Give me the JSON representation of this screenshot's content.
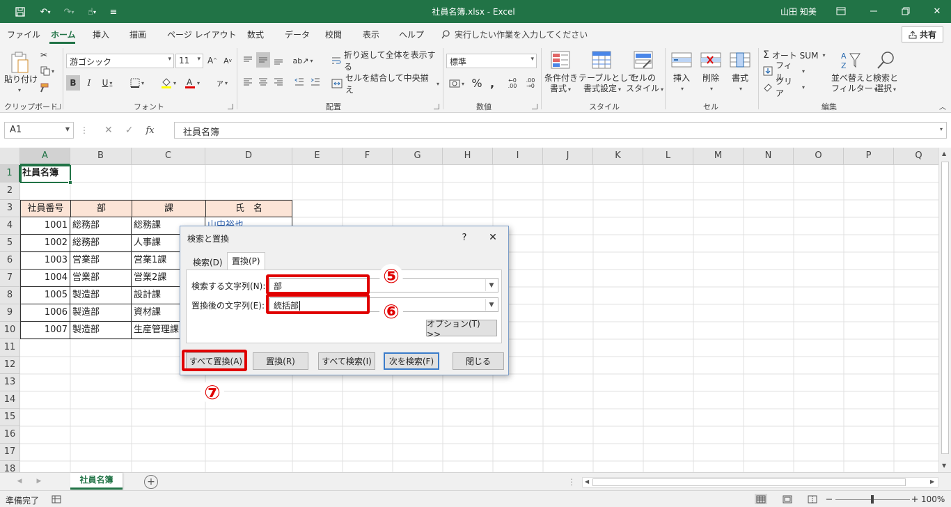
{
  "app": {
    "title": "社員名簿.xlsx  -  Excel",
    "user": "山田 知美"
  },
  "menu": {
    "tabs": [
      "ファイル",
      "ホーム",
      "挿入",
      "描画",
      "ページ レイアウト",
      "数式",
      "データ",
      "校閲",
      "表示",
      "ヘルプ"
    ],
    "tell_me": "実行したい作業を入力してください",
    "share": "共有"
  },
  "ribbon": {
    "clipboard": {
      "paste": "貼り付け",
      "label": "クリップボード"
    },
    "font": {
      "name": "游ゴシック",
      "size": "11",
      "label": "フォント"
    },
    "alignment": {
      "wrap": "折り返して全体を表示する",
      "merge": "セルを結合して中央揃え",
      "label": "配置"
    },
    "number": {
      "format": "標準",
      "label": "数値"
    },
    "styles": {
      "conditional": [
        "条件付き",
        "書式"
      ],
      "table": [
        "テーブルとして",
        "書式設定"
      ],
      "cellstyle": [
        "セルの",
        "スタイル"
      ],
      "label": "スタイル"
    },
    "cells": {
      "insert": "挿入",
      "delete": "削除",
      "format": "書式",
      "label": "セル"
    },
    "editing": {
      "autosum": "オート SUM",
      "fill": "フィル",
      "clear": "クリア",
      "sort": [
        "並べ替えと",
        "フィルター"
      ],
      "find": [
        "検索と",
        "選択"
      ],
      "label": "編集"
    }
  },
  "formula": {
    "namebox": "A1",
    "content": "社員名簿"
  },
  "grid": {
    "columns": [
      "A",
      "B",
      "C",
      "D",
      "E",
      "F",
      "G",
      "H",
      "I",
      "J",
      "K",
      "L",
      "M",
      "N",
      "O",
      "P",
      "Q"
    ],
    "rows": [
      "1",
      "2",
      "3",
      "4",
      "5",
      "6",
      "7",
      "8",
      "9",
      "10",
      "11",
      "12",
      "13",
      "14",
      "15",
      "16",
      "17",
      "18"
    ],
    "title": "社員名簿",
    "headers": [
      "社員番号",
      "部",
      "課",
      "氏　名"
    ],
    "records": [
      [
        "1001",
        "総務部",
        "総務課",
        "山中裕也"
      ],
      [
        "1002",
        "総務部",
        "人事課",
        ""
      ],
      [
        "1003",
        "営業部",
        "営業1課",
        ""
      ],
      [
        "1004",
        "営業部",
        "営業2課",
        ""
      ],
      [
        "1005",
        "製造部",
        "設計課",
        ""
      ],
      [
        "1006",
        "製造部",
        "資材課",
        ""
      ],
      [
        "1007",
        "製造部",
        "生産管理課",
        ""
      ]
    ]
  },
  "dialog": {
    "title": "検索と置換",
    "help": "?",
    "close": "✕",
    "tabs": [
      "検索(D)",
      "置換(P)"
    ],
    "find_label": "検索する文字列(N):",
    "find_value": "部",
    "replace_label": "置換後の文字列(E):",
    "replace_value": "統括部",
    "options": "オプション(T) >>",
    "buttons": [
      "すべて置換(A)",
      "置換(R)",
      "すべて検索(I)",
      "次を検索(F)",
      "閉じる"
    ]
  },
  "annotations": [
    "⑤",
    "⑥",
    "⑦"
  ],
  "sheet": {
    "tab": "社員名簿"
  },
  "status": {
    "ready": "準備完了",
    "zoom": "100%"
  },
  "colors": {
    "excel_green": "#217346",
    "header_fill": "#fce4d6",
    "highlight_red": "#e00000"
  }
}
